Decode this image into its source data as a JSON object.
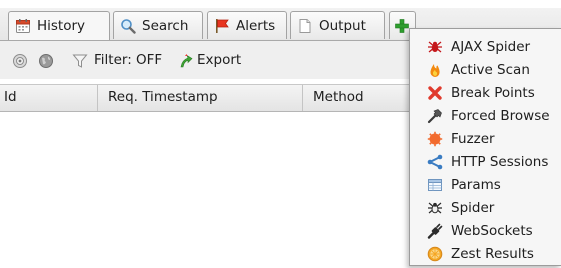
{
  "tabs": [
    {
      "label": "History",
      "icon": "calendar-icon",
      "active": true
    },
    {
      "label": "Search",
      "icon": "magnifier-icon",
      "active": false
    },
    {
      "label": "Alerts",
      "icon": "flag-icon",
      "active": false
    },
    {
      "label": "Output",
      "icon": "document-icon",
      "active": false
    }
  ],
  "add_tab": {
    "icon": "plus-icon",
    "color": "#2e9e2e"
  },
  "toolbar": {
    "filter_label": "Filter: OFF",
    "export_label": "Export"
  },
  "table": {
    "columns": [
      "Id",
      "Req. Timestamp",
      "Method"
    ]
  },
  "menu": {
    "items": [
      {
        "label": "AJAX Spider",
        "icon": "ajax-spider-icon"
      },
      {
        "label": "Active Scan",
        "icon": "flame-icon"
      },
      {
        "label": "Break Points",
        "icon": "red-x-icon"
      },
      {
        "label": "Forced Browse",
        "icon": "hammer-icon"
      },
      {
        "label": "Fuzzer",
        "icon": "fuzzer-icon"
      },
      {
        "label": "HTTP Sessions",
        "icon": "share-icon"
      },
      {
        "label": "Params",
        "icon": "table-icon"
      },
      {
        "label": "Spider",
        "icon": "spider-icon"
      },
      {
        "label": "WebSockets",
        "icon": "plug-icon"
      },
      {
        "label": "Zest Results",
        "icon": "zest-icon"
      }
    ]
  }
}
